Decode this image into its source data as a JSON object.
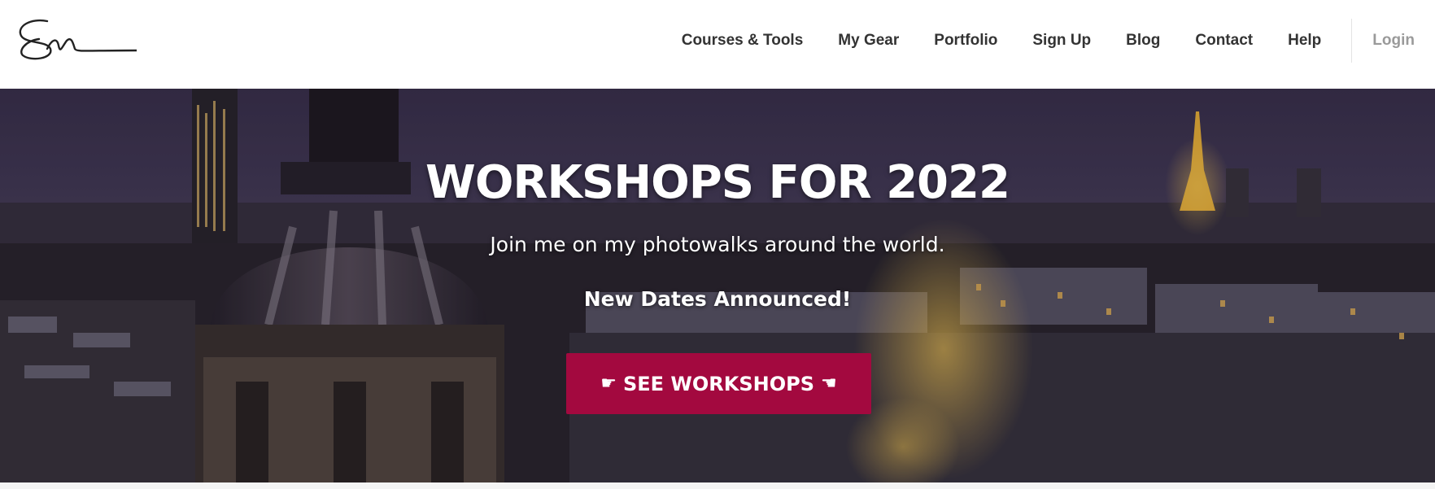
{
  "header": {
    "logo_icon": "signature-logo",
    "nav": [
      {
        "label": "Courses & Tools"
      },
      {
        "label": "My Gear"
      },
      {
        "label": "Portfolio"
      },
      {
        "label": "Sign Up"
      },
      {
        "label": "Blog"
      },
      {
        "label": "Contact"
      },
      {
        "label": "Help"
      }
    ],
    "login_label": "Login"
  },
  "hero": {
    "title": "WORKSHOPS FOR 2022",
    "subtitle": "Join me on my photowalks around the world.",
    "announcement": "New Dates Announced!",
    "cta": {
      "label": "SEE WORKSHOPS",
      "left_icon": "hand-pointing-right-icon",
      "right_icon": "hand-pointing-left-icon",
      "color": "#a3093f"
    }
  }
}
